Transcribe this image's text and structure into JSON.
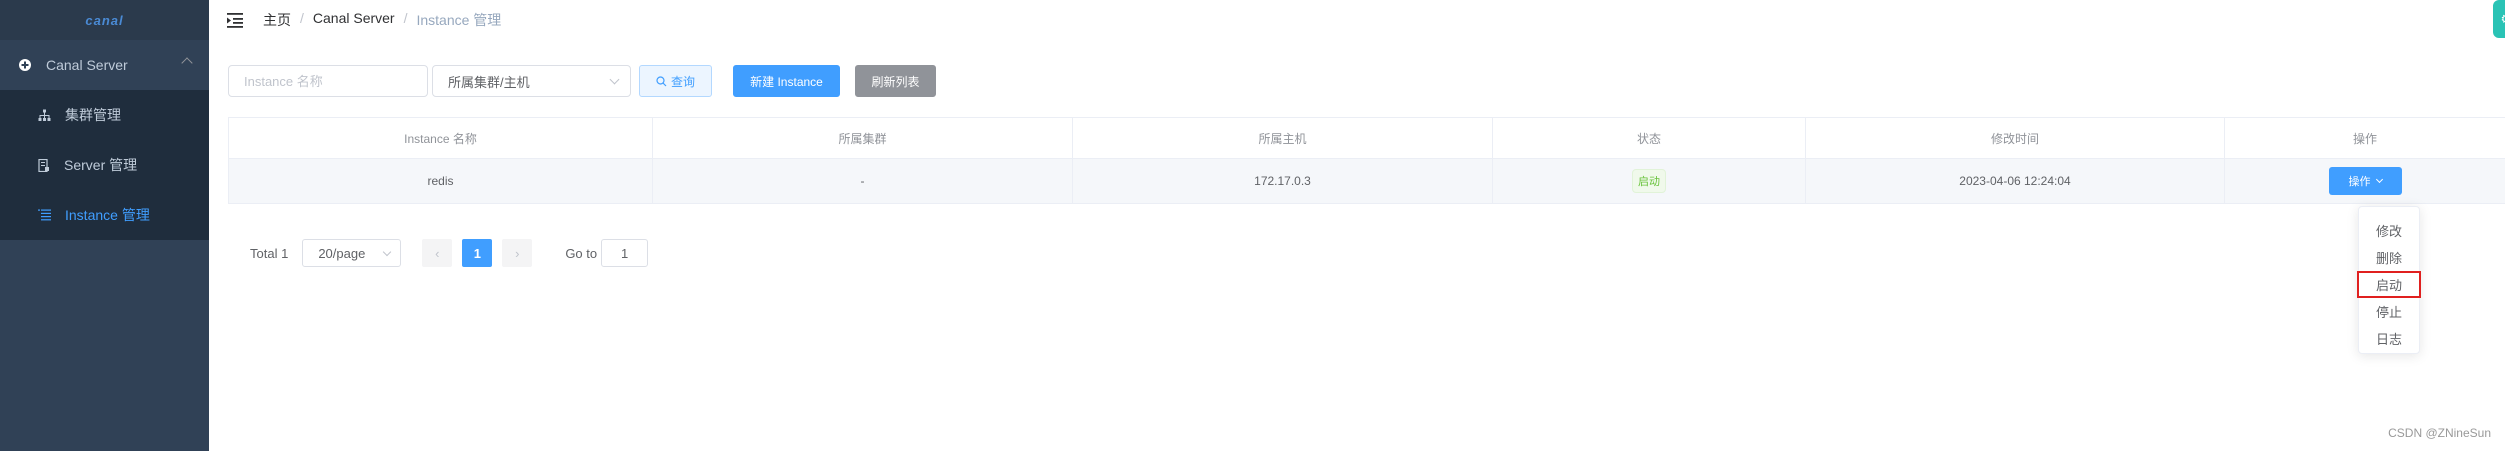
{
  "app": {
    "logo": "canal"
  },
  "sidebar": {
    "group_label": "Canal Server",
    "items": [
      {
        "label": "集群管理",
        "icon": "cluster-icon"
      },
      {
        "label": "Server 管理",
        "icon": "server-icon"
      },
      {
        "label": "Instance 管理",
        "icon": "list-icon"
      }
    ]
  },
  "breadcrumb": {
    "home": "主页",
    "section": "Canal Server",
    "current": "Instance 管理"
  },
  "filters": {
    "name_placeholder": "Instance 名称",
    "cluster_select": "所属集群/主机",
    "query_label": "查询",
    "new_label": "新建 Instance",
    "refresh_label": "刷新列表"
  },
  "table": {
    "headers": [
      "Instance 名称",
      "所属集群",
      "所属主机",
      "状态",
      "修改时间",
      "操作"
    ],
    "rows": [
      {
        "name": "redis",
        "cluster": "-",
        "host": "172.17.0.3",
        "status": "启动",
        "modified": "2023-04-06 12:24:04",
        "action": "操作"
      }
    ]
  },
  "pagination": {
    "total": "Total 1",
    "page_size": "20/page",
    "current_page": "1",
    "goto_label": "Go to",
    "goto_value": "1"
  },
  "dropdown": {
    "items": [
      "修改",
      "删除",
      "启动",
      "停止",
      "日志"
    ],
    "highlighted": "启动"
  },
  "watermark": "CSDN @ZNineSun",
  "colors": {
    "primary": "#409eff",
    "sidebar": "#304156",
    "success": "#67c23a",
    "highlight_box": "#e0201f"
  }
}
